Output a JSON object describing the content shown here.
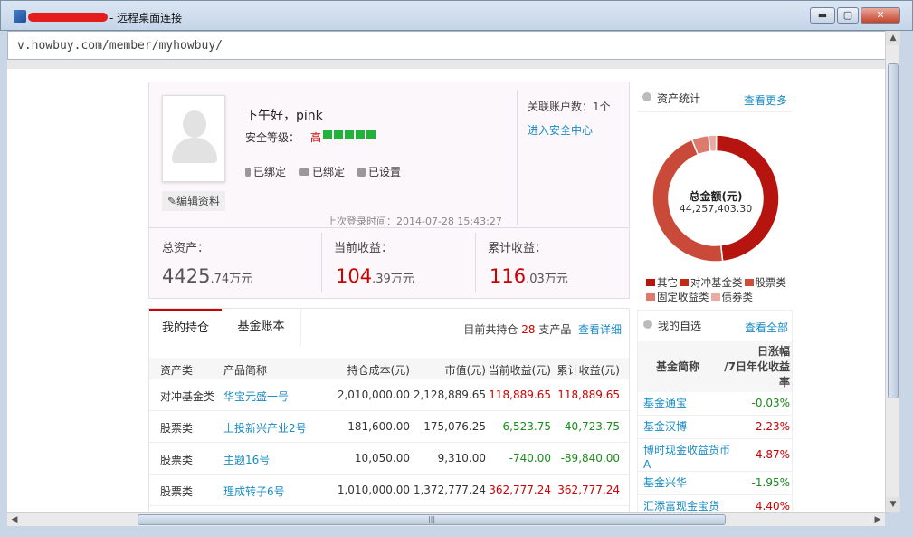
{
  "window": {
    "title": "- 远程桌面连接",
    "min_label": "▬",
    "max_label": "▢",
    "close_label": "✕"
  },
  "address": {
    "url": "v.howbuy.com/member/myhowbuy/"
  },
  "profile": {
    "greeting": "下午好，pink",
    "security_label": "安全等级：",
    "security_level": "高",
    "security_bars": 5,
    "phone_bound": "已绑定",
    "email_bound": "已绑定",
    "password_set": "已设置",
    "edit_profile": "✎编辑资料",
    "last_login": "上次登录时间：2014-07-28 15:43:27",
    "linked_accounts": "关联账户数：1个",
    "security_center": "进入安全中心"
  },
  "stats": {
    "total_label": "总资产：",
    "total_int": "4425",
    "total_dec": ".74万元",
    "current_label": "当前收益：",
    "current_int": "104",
    "current_dec": ".39万元",
    "cumulative_label": "累计收益：",
    "cumulative_int": "116",
    "cumulative_dec": ".03万元"
  },
  "assets": {
    "title": "资产统计",
    "more": "查看更多",
    "center_label": "总金额(元)",
    "center_value": "44,257,403.30",
    "legend": [
      {
        "name": "其它",
        "color": "#b5150e"
      },
      {
        "name": "对冲基金类",
        "color": "#c22a14"
      },
      {
        "name": "股票类",
        "color": "#cf4b3a"
      },
      {
        "name": "固定收益类",
        "color": "#dc7a6e"
      },
      {
        "name": "债券类",
        "color": "#e9aaa2"
      }
    ],
    "slices": [
      {
        "name": "对冲基金类",
        "value": 48.1,
        "color": "#b5150e"
      },
      {
        "name": "股票类",
        "value": 45.6,
        "color": "#c94a38"
      },
      {
        "name": "固定收益类",
        "value": 4.3,
        "color": "#dc7a6e"
      },
      {
        "name": "债券类",
        "value": 2.0,
        "color": "#e9aaa2"
      }
    ]
  },
  "holdings": {
    "tab_active": "我的持仓",
    "tab_other": "基金账本",
    "summary_prefix": "目前共持仓",
    "summary_count": "28",
    "summary_suffix": "支产品",
    "detail_link": "查看详细",
    "headers": [
      "资产类",
      "产品简称",
      "持仓成本(元)",
      "市值(元)",
      "当前收益(元)",
      "累计收益(元)"
    ],
    "rows": [
      {
        "type": "对冲基金类",
        "name": "华宝元盛一号",
        "cost": "2,010,000.00",
        "market": "2,128,889.65",
        "current": "118,889.65",
        "cumulative": "118,889.65",
        "current_neg": false,
        "cum_neg": false
      },
      {
        "type": "股票类",
        "name": "上投新兴产业2号",
        "cost": "181,600.00",
        "market": "175,076.25",
        "current": "-6,523.75",
        "cumulative": "-40,723.75",
        "current_neg": true,
        "cum_neg": true
      },
      {
        "type": "股票类",
        "name": "主题16号",
        "cost": "10,050.00",
        "market": "9,310.00",
        "current": "-740.00",
        "cumulative": "-89,840.00",
        "current_neg": true,
        "cum_neg": true
      },
      {
        "type": "股票类",
        "name": "理成转子6号",
        "cost": "1,010,000.00",
        "market": "1,372,777.24",
        "current": "362,777.24",
        "cumulative": "362,777.24",
        "current_neg": false,
        "cum_neg": false
      }
    ]
  },
  "watchlist": {
    "title": "我的自选",
    "all_link": "查看全部",
    "col_name": "基金简称",
    "col_rate_1": "日涨幅",
    "col_rate_2": "/7日年化收益",
    "col_rate_3": "率",
    "rows": [
      {
        "name": "基金通宝",
        "rate": "-0.03%",
        "neg": true
      },
      {
        "name": "基金汉博",
        "rate": "2.23%",
        "neg": false
      },
      {
        "name": "博时现金收益货币A",
        "rate": "4.87%",
        "neg": false
      },
      {
        "name": "基金兴华",
        "rate": "-1.95%",
        "neg": true
      },
      {
        "name": "汇添富现金宝货",
        "rate": "4.40%",
        "neg": false
      }
    ]
  }
}
